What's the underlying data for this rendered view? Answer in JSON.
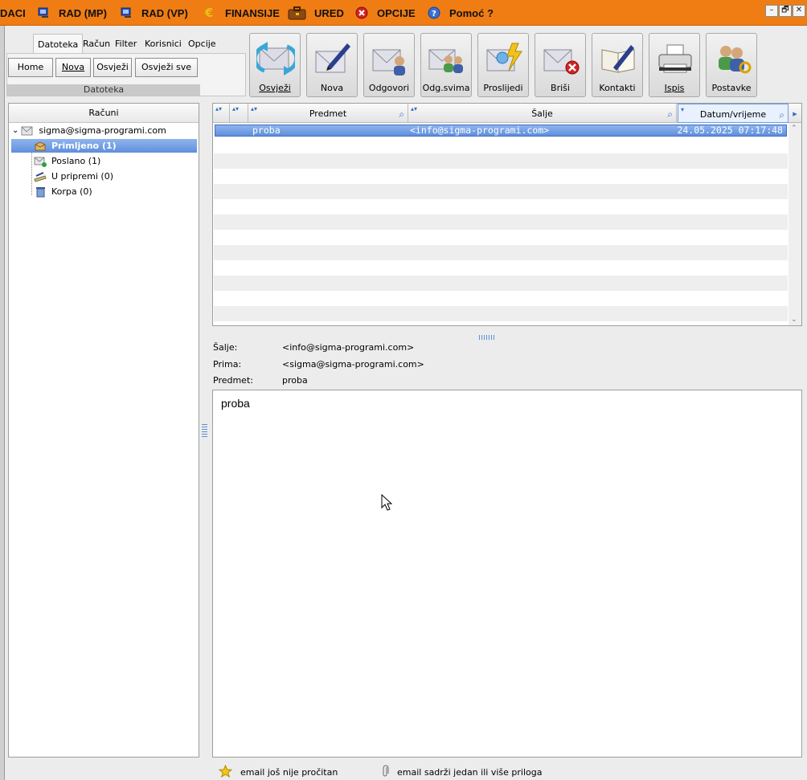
{
  "menubar": {
    "items": [
      {
        "label": "DACI"
      },
      {
        "label": "RAD (MP)"
      },
      {
        "label": "RAD (VP)"
      },
      {
        "label": "FINANSIJE"
      },
      {
        "label": "URED"
      },
      {
        "label": "OPCIJE"
      },
      {
        "label": "Pomoć ?"
      }
    ],
    "window_buttons": [
      "–",
      "🗗",
      "✕"
    ]
  },
  "ribbon": {
    "tabs": [
      "Datoteka",
      "Račun",
      "Filter",
      "Korisnici",
      "Opcije"
    ],
    "active_tab": "Datoteka",
    "buttons": [
      "Home",
      "Nova",
      "Osvježi",
      "Osvježi sve"
    ],
    "group_caption": "Datoteka"
  },
  "toolbar": {
    "buttons": [
      {
        "label": "Osvježi",
        "icon": "refresh-icon"
      },
      {
        "label": "Nova",
        "icon": "new-mail-icon"
      },
      {
        "label": "Odgovori",
        "icon": "reply-icon"
      },
      {
        "label": "Odg.svima",
        "icon": "reply-all-icon"
      },
      {
        "label": "Proslijedi",
        "icon": "forward-icon"
      },
      {
        "label": "Briši",
        "icon": "delete-mail-icon"
      },
      {
        "label": "Kontakti",
        "icon": "contacts-icon"
      },
      {
        "label": "Ispis",
        "icon": "printer-icon"
      },
      {
        "label": "Postavke",
        "icon": "settings-users-icon"
      }
    ]
  },
  "accounts": {
    "header": "Računi",
    "account": "sigma@sigma-programi.com",
    "folders": [
      {
        "label": "Primljeno (1)",
        "icon": "inbox-icon",
        "selected": true
      },
      {
        "label": "Poslano (1)",
        "icon": "sent-icon",
        "selected": false
      },
      {
        "label": "U pripremi (0)",
        "icon": "drafts-icon",
        "selected": false
      },
      {
        "label": "Korpa (0)",
        "icon": "trash-icon",
        "selected": false
      }
    ]
  },
  "message_list": {
    "columns": [
      "Predmet",
      "Šalje",
      "Datum/vrijeme"
    ],
    "rows": [
      {
        "subject": "proba",
        "from": "<info@sigma-programi.com>",
        "date": "24.05.2025 07:17:48",
        "selected": true
      }
    ]
  },
  "message_header": {
    "from_label": "Šalje:",
    "from_value": "<info@sigma-programi.com>",
    "to_label": "Prima:",
    "to_value": "<sigma@sigma-programi.com>",
    "subject_label": "Predmet:",
    "subject_value": "proba"
  },
  "message_body": "proba",
  "legend": {
    "unread": "email još nije pročitan",
    "attachment": "email sadrži jedan ili više priloga"
  },
  "colors": {
    "menubar": "#f07d14",
    "selection": "#6f9ae0"
  }
}
